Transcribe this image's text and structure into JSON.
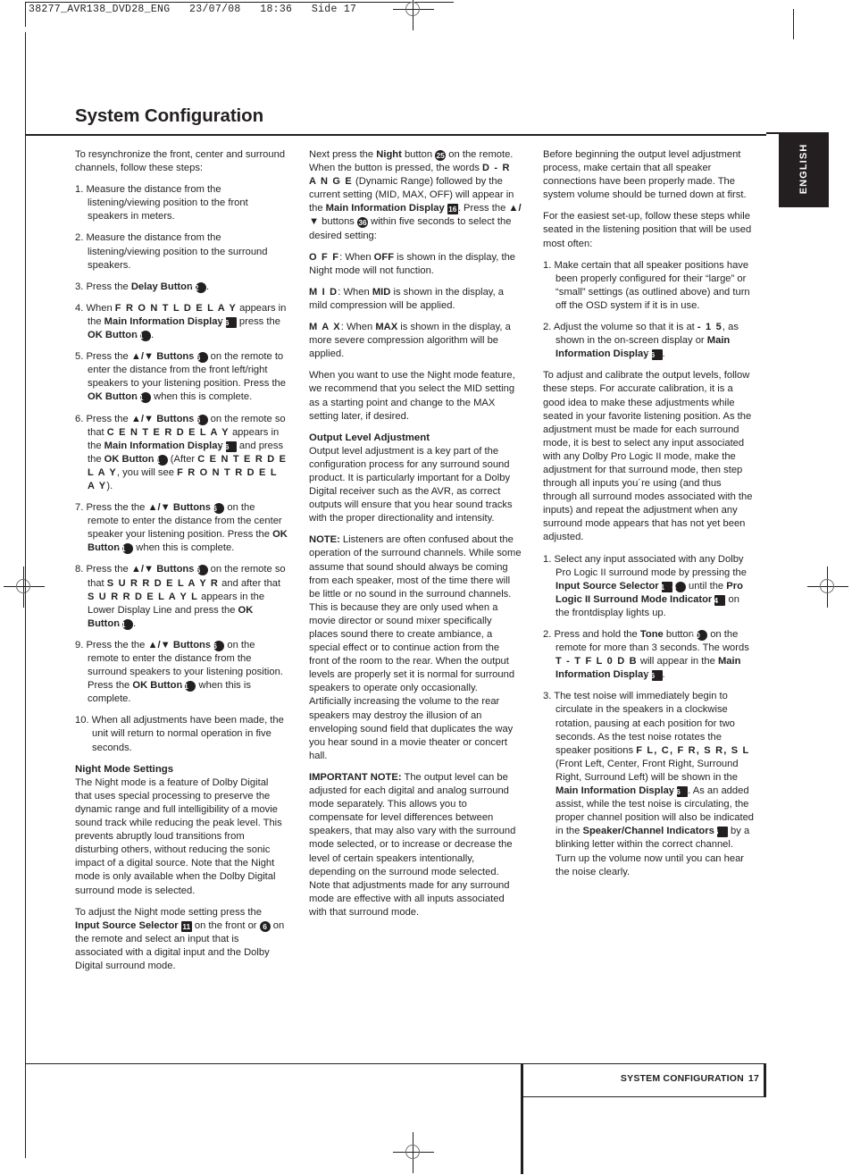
{
  "print_slug": "38277_AVR138_DVD28_ENG   23/07/08   18:36   Side 17",
  "language_tab": "ENGLISH",
  "page_title": "System Configuration",
  "footer": {
    "section": "SYSTEM CONFIGURATION",
    "page_number": "17"
  },
  "columns": {
    "left": {
      "intro": "To resynchronize the front, center and surround channels, follow these steps:",
      "steps": [
        {
          "num": "1.",
          "text": "Measure the distance from the listening/viewing position to the front speakers in meters."
        },
        {
          "num": "2.",
          "text": "Measure the distance from the listening/viewing position to the surround speakers."
        },
        {
          "num": "3.",
          "pre": "Press the ",
          "bold1": "Delay Button",
          "badge1": "12",
          "post": "."
        },
        {
          "num": "4.",
          "pre": "When ",
          "lcd1": "F R O N T L  D E L A Y",
          "mid1": " appears in the ",
          "bold1": "Main Information Display",
          "badge1": "16",
          "mid2": " press the ",
          "bold2": "OK Button",
          "badge2": "11",
          "post": "."
        },
        {
          "num": "5.",
          "pre": "Press the ",
          "arrows": "▲/▼",
          "bold1": "Buttons",
          "badge1": "36",
          "mid1": " on the remote to enter the distance from the front left/right speakers to your listening position. Press the ",
          "bold2": "OK Button",
          "badge2": "11",
          "post": " when this is complete."
        },
        {
          "num": "6.",
          "pre": "Press the ",
          "arrows": "▲/▼",
          "bold1": "Buttons",
          "badge1": "36",
          "mid1": " on the remote so that ",
          "lcd1": "C E N T E R  D E L A Y",
          "mid2": " appears in the ",
          "bold2": "Main Information Display",
          "badge2": "16",
          "mid3": " and press the ",
          "bold3": "OK Button",
          "badge3": "11",
          "mid4": " (After ",
          "lcd2": "C E N T E R  D E L A Y",
          "mid5": ", you will see ",
          "lcd3": "F R O N T R  D E L A Y",
          "post": ")."
        },
        {
          "num": "7.",
          "pre": "Press the the ",
          "arrows": "▲/▼",
          "bold1": "Buttons",
          "badge1": "36",
          "mid1": " on the remote to enter the distance from the center speaker your listening position. Press the ",
          "bold2": "OK Button",
          "badge2": "11",
          "post": " when this is complete."
        },
        {
          "num": "8.",
          "pre": "Press the ",
          "arrows": "▲/▼",
          "bold1": "Buttons",
          "badge1": "36",
          "mid1": " on the remote so that ",
          "lcd1": "S U R R  D E L A Y  R",
          "mid2": " and after that ",
          "lcd2": "S U R R  D E L A Y  L",
          "mid3": " appears in the Lower Display Line and press the ",
          "bold2": "OK Button",
          "badge2": "11",
          "post": "."
        },
        {
          "num": "9.",
          "pre": "Press the the ",
          "arrows": "▲/▼",
          "bold1": "Buttons",
          "badge1": "36",
          "mid1": " on the remote to enter the distance from the surround speakers to your listening position. Press the ",
          "bold2": "OK Button",
          "badge2": "11",
          "post": " when this is complete."
        },
        {
          "num": "10.",
          "text": "When all adjustments have been made, the unit will return to normal operation in five seconds."
        }
      ],
      "night_mode_heading": "Night Mode Settings",
      "night_mode_body": "The Night mode is a feature of Dolby Digital that uses special processing to preserve the dynamic range and full intelligibility of a movie sound track while reducing the peak level. This prevents abruptly loud transitions from disturbing others, without reducing the sonic impact of a digital source. Note that the Night mode is only available when the Dolby Digital surround mode is selected.",
      "night_adjust": {
        "pre": "To adjust the Night mode setting press the ",
        "bold1": "Input Source Selector",
        "badge1": "11",
        "mid1": " on the front or ",
        "badge2": "6",
        "post": " on the remote and select an input that is associated with a digital input and the Dolby Digital surround mode."
      }
    },
    "middle": {
      "night_press": {
        "pre": "Next press the ",
        "bold1": "Night",
        "mid1": " button ",
        "badge1": "25",
        "mid2": " on the remote. When the button is pressed, the words ",
        "lcd1": "D - R A N G E",
        "mid3": " (Dynamic Range) followed by the current setting (MID, MAX, OFF) will appear in the ",
        "bold2": "Main Information Display",
        "badge2": "16",
        "mid4": ". Press the ",
        "arrows": "▲/▼",
        "mid5": " buttons ",
        "badge3": "36",
        "post": " within five seconds to select the desired setting:"
      },
      "settings": [
        {
          "lcd": "O F F",
          "pre": ":  When ",
          "bold": "OFF",
          "post": " is shown in the display, the Night mode will not function."
        },
        {
          "lcd": "M I D",
          "pre": ":  When ",
          "bold": "MID",
          "post": " is shown in the display, a mild compression will be applied."
        },
        {
          "lcd": "M A X",
          "pre": ":  When ",
          "bold": "MAX",
          "post": " is shown in the display, a more severe compression algorithm will be applied."
        }
      ],
      "recommend": "When you want to use the Night mode feature, we recommend that you select the MID setting as a starting point and change to the MAX setting later, if desired.",
      "output_heading": "Output Level Adjustment",
      "output_body": "Output level adjustment is a key part of the configuration process for any surround sound product. It is particularly important for a Dolby Digital receiver such as the AVR, as correct outputs will ensure that you hear sound tracks with the proper directionality and intensity.",
      "note_label": "NOTE:",
      "note_body": " Listeners are often confused about the operation of the surround channels. While some assume that sound should always be coming from each speaker, most of the time there will be little or no sound in the surround channels. This is because they are only used when a movie director or sound mixer specifically places sound there to create ambiance, a special effect or to continue action from the front of the room to the rear. When the output levels are properly set it is normal for surround speakers to operate only occasionally. Artificially increasing the volume to the rear speakers may destroy the illusion of an enveloping sound field that duplicates the way you hear sound in a movie theater or concert hall.",
      "important_label": "IMPORTANT NOTE:",
      "important_body": " The output level can be adjusted for each digital and analog surround mode separately. This allows you to compensate for level differences between speakers, that may also vary with the surround mode selected, or to increase or decrease the level of certain speakers intentionally, depending on the surround mode selected. Note that adjustments made for any surround mode are effective with all inputs associated with that surround mode."
    },
    "right": {
      "before": "Before beginning the output level adjustment process, make certain that all speaker connections have been properly made. The system volume should be turned down at first.",
      "easiest": "For the easiest set-up, follow these steps while seated in the listening position that will be used most often:",
      "steps": [
        {
          "num": "1.",
          "text": "Make certain that all speaker positions have been properly configured for their “large” or “small” settings (as outlined above) and turn off the OSD system if it is in use."
        },
        {
          "num": "2.",
          "pre": "Adjust the volume so that it is at ",
          "lcd1": "- 1 5",
          "mid1": ", as shown in the on-screen display or ",
          "bold1": "Main Information Display",
          "badge1": "16",
          "post": "."
        }
      ],
      "calibrate": "To adjust and calibrate the output levels, follow these steps. For accurate calibration, it is a good idea to make these adjustments while seated in your favorite listening position. As the adjustment must be made for each surround mode, it is best to select any input associated with any Dolby Pro Logic II mode, make the adjustment for that surround mode, then step through all inputs you´re using (and thus through all surround modes associated with the inputs) and repeat the adjustment when any surround mode appears that has not yet been adjusted.",
      "steps2": [
        {
          "num": "1.",
          "pre": "Select any input associated with any Dolby Pro Logic II surround mode by pressing the ",
          "bold1": "Input Source Selector",
          "badge1": "11",
          "badge2": "6",
          "mid1": " until the ",
          "bold2": "Pro Logic II Surround Mode Indicator",
          "badge3": "14",
          "post": " on the frontdisplay lights up."
        },
        {
          "num": "2.",
          "pre": "Press and hold the ",
          "bold1": "Tone",
          "mid1": " button ",
          "badge1": "30",
          "mid2": " on the remote for more than 3 seconds. The words ",
          "lcd1": "T - T  F L   0 D B",
          "mid3": " will appear in the ",
          "bold2": "Main Information Display",
          "badge2": "16",
          "post": "."
        },
        {
          "num": "3.",
          "pre": "The test noise will immediately begin to circulate in the speakers in a clockwise rotation, pausing at each position for two seconds. As the test noise rotates the speaker positions ",
          "lcd1": "F L,  C,  F R,  S R,  S L",
          "mid1": " (Front Left, Center, Front Right, Surround Right, Surround Left) will be shown in the ",
          "bold1": "Main Information Display",
          "badge1": "16",
          "mid2": ". As an added assist, while the test noise is circulating, the proper channel position will also be indicated in the ",
          "bold2": "Speaker/Channel Indicators",
          "badge2": "6",
          "post": " by a blinking letter within the correct channel. Turn up the volume now until you can hear the noise clearly."
        }
      ]
    }
  }
}
